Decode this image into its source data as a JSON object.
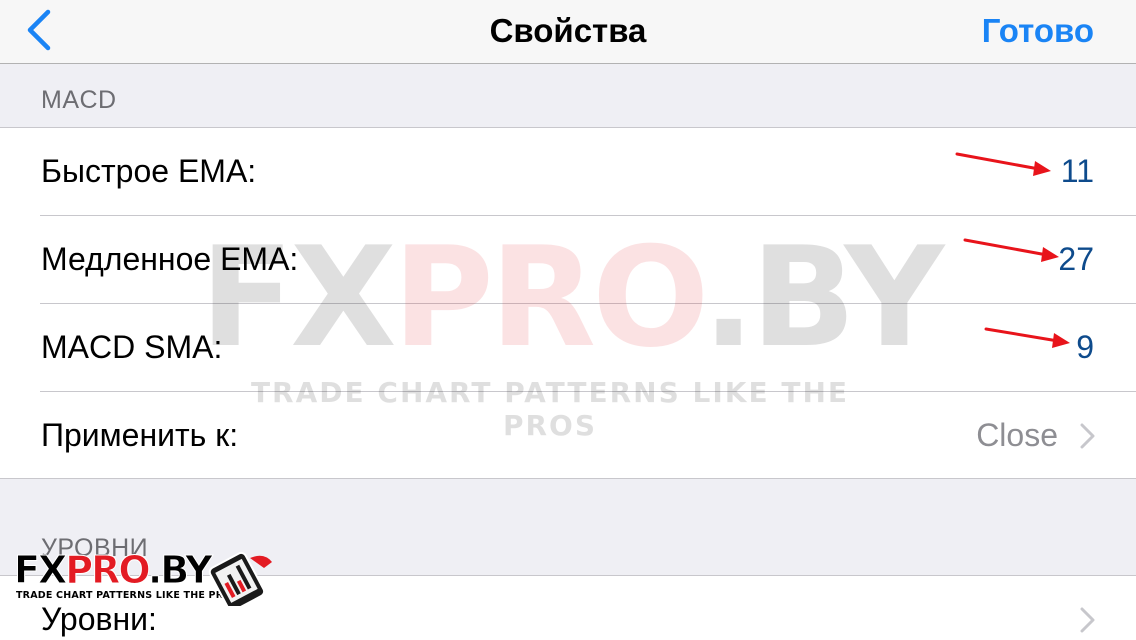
{
  "navbar": {
    "title": "Свойства",
    "done_label": "Готово",
    "back_icon": "chevron-left-icon",
    "accent_color": "#1a84f5"
  },
  "sections": {
    "macd": {
      "header": "MACD",
      "rows": [
        {
          "label": "Быстрое EMA:",
          "value": "11"
        },
        {
          "label": "Медленное EMA:",
          "value": "27"
        },
        {
          "label": "MACD SMA:",
          "value": "9"
        },
        {
          "label": "Применить к:",
          "detail": "Close"
        }
      ]
    },
    "levels": {
      "header": "УРОВНИ",
      "rows": [
        {
          "label": "Уровни:"
        }
      ]
    }
  },
  "annotations": {
    "arrow_color": "#e8141b",
    "arrow_icon": "red-arrow-icon"
  },
  "watermark": {
    "main_black_1": "FX",
    "main_red": "PRO",
    "main_black_2": ".BY",
    "tagline": "TRADE CHART PATTERNS LIKE THE PROS"
  },
  "logo": {
    "text_black_1": "FX",
    "text_red": "PRO",
    "text_black_2": ".BY",
    "tagline": "TRADE CHART PATTERNS LIKE THE PROS"
  }
}
